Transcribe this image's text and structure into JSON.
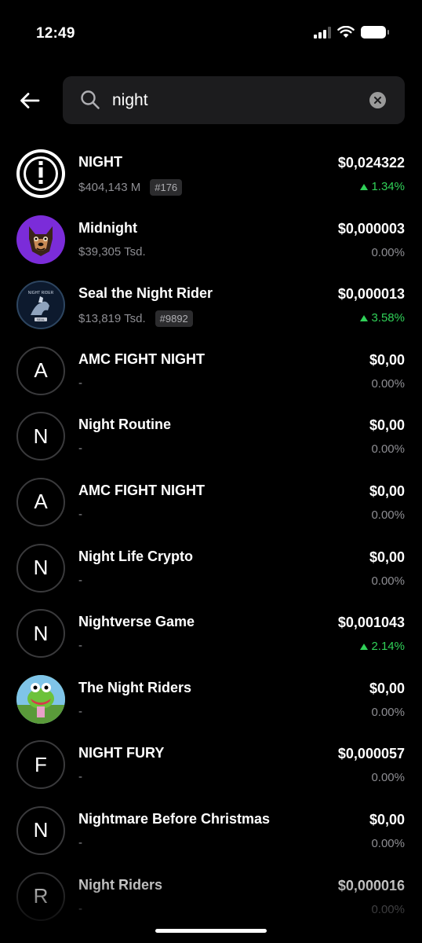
{
  "status_bar": {
    "time": "12:49",
    "battery_level": 0.85
  },
  "search": {
    "query": "night",
    "placeholder": ""
  },
  "colors": {
    "background": "#000000",
    "positive": "#30d158",
    "muted": "#8e8e93",
    "search_bg": "#1c1c1e"
  },
  "results": [
    {
      "name": "NIGHT",
      "sub": "$404,143 M",
      "rank": "#176",
      "price": "$0,024322",
      "change": "1.34%",
      "up": true,
      "avatar": "night-logo"
    },
    {
      "name": "Midnight",
      "sub": "$39,305 Tsd.",
      "rank": "",
      "price": "$0,000003",
      "change": "0.00%",
      "up": false,
      "avatar": "midnight-dog-logo"
    },
    {
      "name": "Seal the Night Rider",
      "sub": "$13,819 Tsd.",
      "rank": "#9892",
      "price": "$0,000013",
      "change": "3.58%",
      "up": true,
      "avatar": "seal-rider-logo"
    },
    {
      "name": "AMC FIGHT NIGHT",
      "sub": "-",
      "rank": "",
      "price": "$0,00",
      "change": "0.00%",
      "up": false,
      "avatar": "A"
    },
    {
      "name": "Night Routine",
      "sub": "-",
      "rank": "",
      "price": "$0,00",
      "change": "0.00%",
      "up": false,
      "avatar": "N"
    },
    {
      "name": "AMC FIGHT NIGHT",
      "sub": "-",
      "rank": "",
      "price": "$0,00",
      "change": "0.00%",
      "up": false,
      "avatar": "A"
    },
    {
      "name": "Night Life Crypto",
      "sub": "-",
      "rank": "",
      "price": "$0,00",
      "change": "0.00%",
      "up": false,
      "avatar": "N"
    },
    {
      "name": "Nightverse Game",
      "sub": "-",
      "rank": "",
      "price": "$0,001043",
      "change": "2.14%",
      "up": true,
      "avatar": "N"
    },
    {
      "name": "The Night Riders",
      "sub": "-",
      "rank": "",
      "price": "$0,00",
      "change": "0.00%",
      "up": false,
      "avatar": "night-riders-frog-logo"
    },
    {
      "name": "NIGHT FURY",
      "sub": "-",
      "rank": "",
      "price": "$0,000057",
      "change": "0.00%",
      "up": false,
      "avatar": "F"
    },
    {
      "name": "Nightmare Before Christmas",
      "sub": "-",
      "rank": "",
      "price": "$0,00",
      "change": "0.00%",
      "up": false,
      "avatar": "N"
    },
    {
      "name": "Night Riders",
      "sub": "-",
      "rank": "",
      "price": "$0,000016",
      "change": "0.00%",
      "up": false,
      "avatar": "R"
    }
  ]
}
